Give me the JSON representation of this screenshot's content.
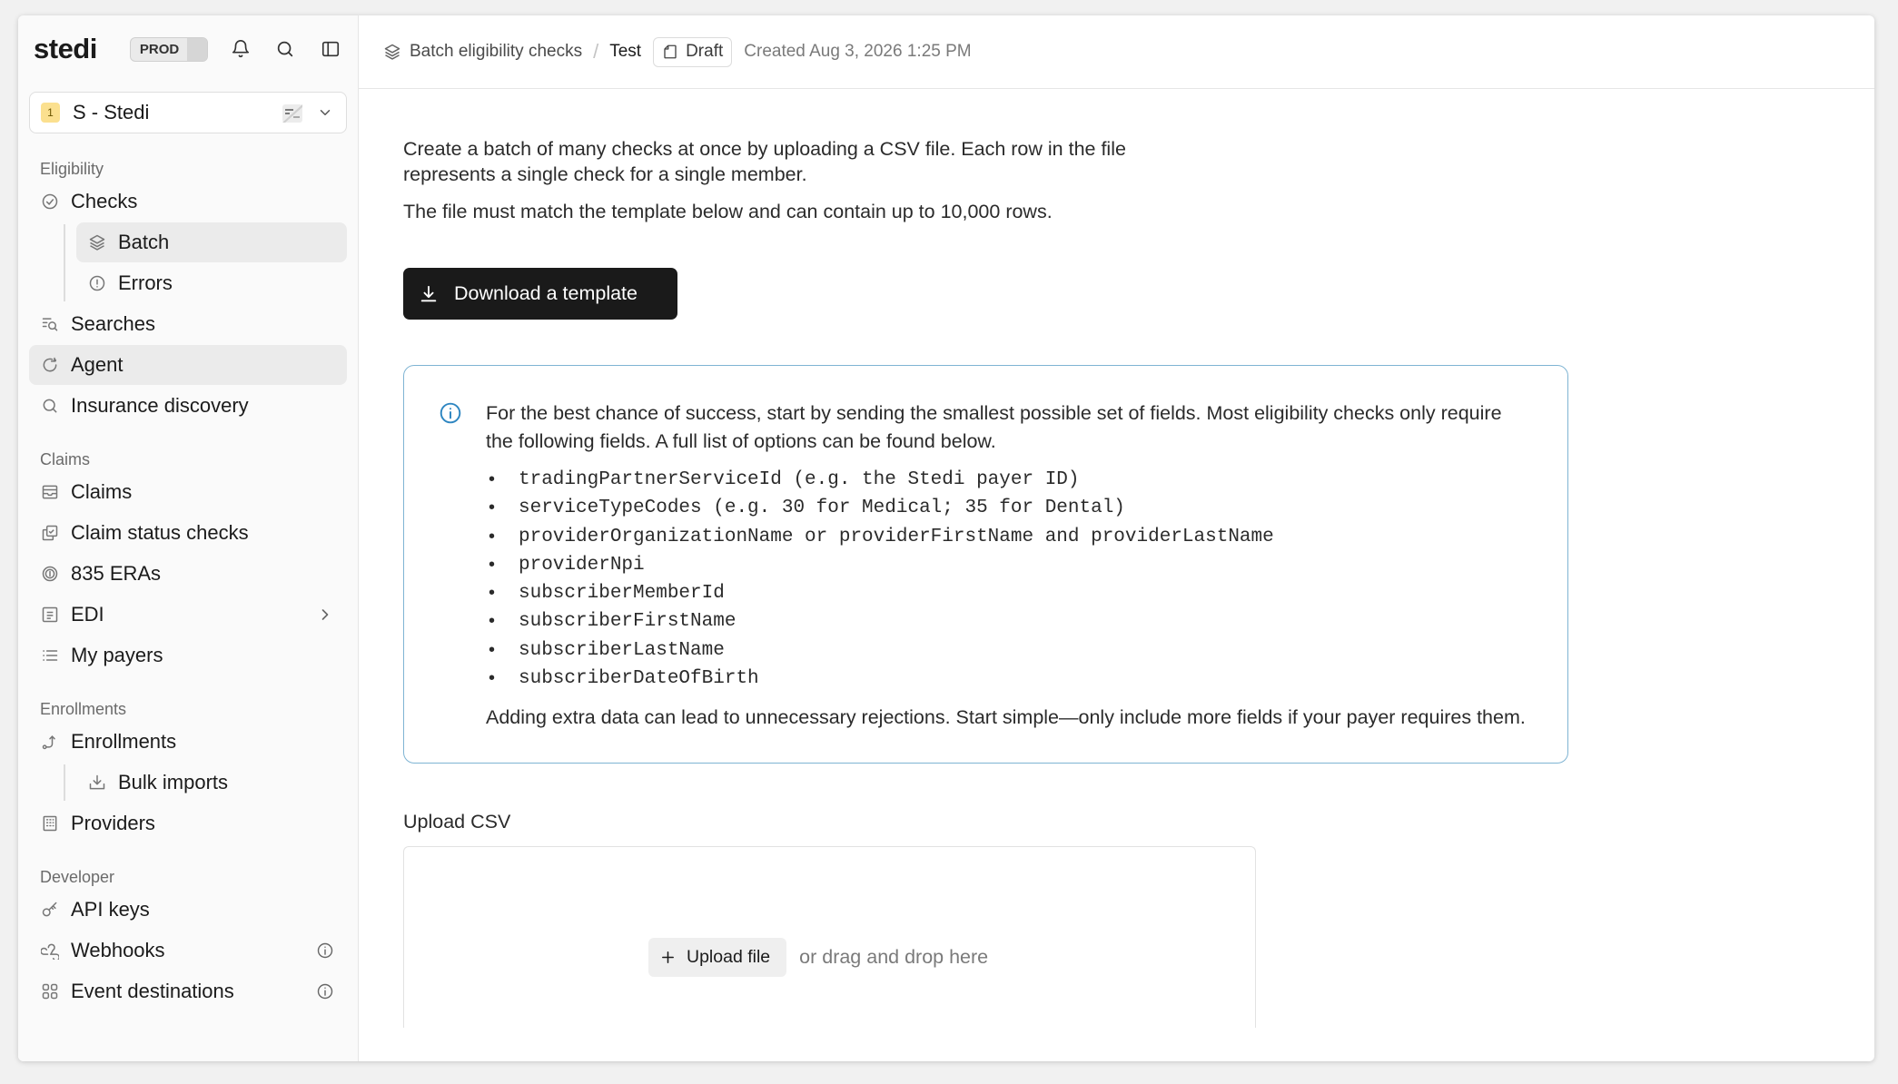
{
  "sidebar": {
    "logo": "stedi",
    "env_badge": "PROD",
    "org": {
      "number": "1",
      "name": "S - Stedi"
    },
    "sections": {
      "eligibility": "Eligibility",
      "claims": "Claims",
      "enrollments": "Enrollments",
      "developer": "Developer"
    },
    "items": {
      "checks": "Checks",
      "batch": "Batch",
      "errors": "Errors",
      "searches": "Searches",
      "agent": "Agent",
      "insurance_discovery": "Insurance discovery",
      "claims": "Claims",
      "claim_status_checks": "Claim status checks",
      "eras": "835 ERAs",
      "edi": "EDI",
      "my_payers": "My payers",
      "enrollments": "Enrollments",
      "bulk_imports": "Bulk imports",
      "providers": "Providers",
      "api_keys": "API keys",
      "webhooks": "Webhooks",
      "event_destinations": "Event destinations"
    }
  },
  "header": {
    "breadcrumb_root": "Batch eligibility checks",
    "breadcrumb_sep": "/",
    "breadcrumb_current": "Test",
    "status": "Draft",
    "created": "Created Aug 3, 2026 1:25 PM"
  },
  "main": {
    "intro": "Create a batch of many checks at once by uploading a CSV file. Each row in the file represents a single check for a single member.",
    "intro2": "The file must match the template below and can contain up to 10,000 rows.",
    "download_button": "Download a template",
    "info": {
      "lead": "For the best chance of success, start by sending the smallest possible set of fields. Most eligibility checks only require the following fields. A full list of options can be found below.",
      "fields": [
        "tradingPartnerServiceId (e.g. the Stedi payer ID)",
        "serviceTypeCodes (e.g. 30 for Medical; 35 for Dental)",
        "providerOrganizationName or providerFirstName and providerLastName",
        "providerNpi",
        "subscriberMemberId",
        "subscriberFirstName",
        "subscriberLastName",
        "subscriberDateOfBirth"
      ],
      "tail": "Adding extra data can lead to unnecessary rejections. Start simple—only include more fields if your payer requires them."
    },
    "upload_label": "Upload CSV",
    "upload_button": "Upload file",
    "upload_hint": "or drag and drop here"
  }
}
